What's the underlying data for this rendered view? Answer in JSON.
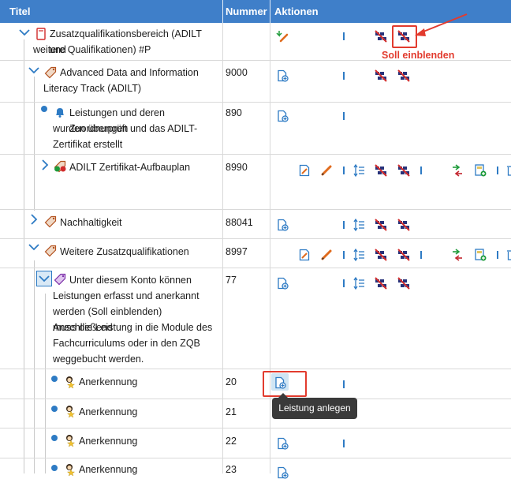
{
  "header": {
    "title": "Titel",
    "number": "Nummer",
    "actions": "Aktionen"
  },
  "rows": [
    {
      "title_l1": "Zusatzqualifikationsbereich (ADILT und",
      "title_l2": "weitere Qualifikationen) #P",
      "number": ""
    },
    {
      "title_l1": "Advanced Data and Information",
      "title_l2": "Literacy Track (ADILT)",
      "number": "9000"
    },
    {
      "title_l1": "Leistungen und deren Zuordnungen",
      "title_l2": "wurden überprüft und das ADILT-",
      "title_l3": "Zertifikat erstellt",
      "number": "890"
    },
    {
      "title_l1": "ADILT Zertifikat-Aufbauplan",
      "number": "8990"
    },
    {
      "title_l1": "Nachhaltigkeit",
      "number": "88041"
    },
    {
      "title_l1": "Weitere Zusatzqualifikationen",
      "number": "8997"
    },
    {
      "title_l1": "Unter diesem Konto können",
      "title_l2": "Leistungen erfasst und anerkannt",
      "title_l3": "werden (Soll einblenden) Anschließend",
      "title_l4": "muss die Leistung in die Module des",
      "title_l5": "Fachcurriculums oder in den ZQB",
      "title_l6": "weggebucht werden.",
      "number": "77"
    },
    {
      "title_l1": "Anerkennung",
      "number": "20"
    },
    {
      "title_l1": "Anerkennung",
      "number": "21"
    },
    {
      "title_l1": "Anerkennung",
      "number": "22"
    },
    {
      "title_l1": "Anerkennung",
      "number": "23"
    }
  ],
  "annotation": {
    "label": "Soll einblenden"
  },
  "tooltip": {
    "text": "Leistung anlegen"
  },
  "colors": {
    "header": "#3f7fc9",
    "accent": "#2e7bc4",
    "annotation": "#e23b2e"
  }
}
